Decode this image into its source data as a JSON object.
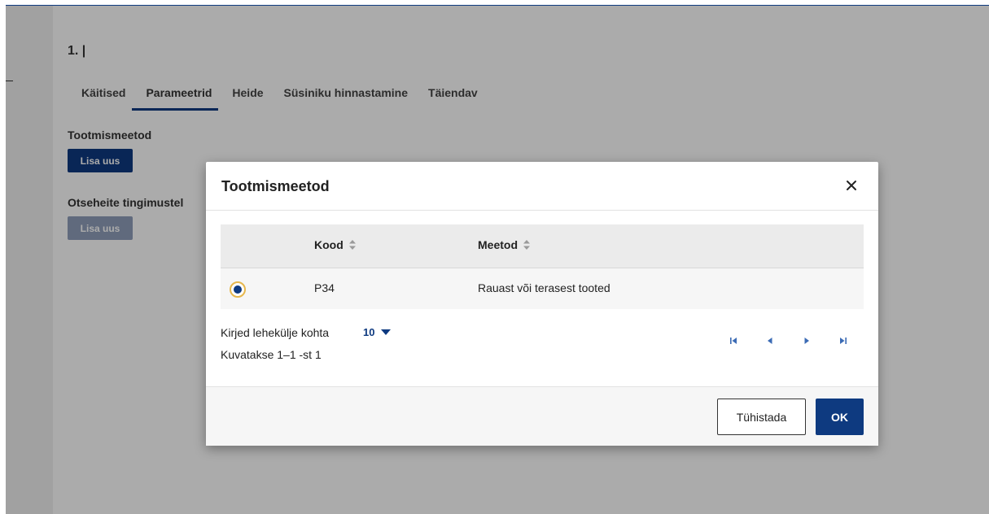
{
  "page": {
    "title": "1. |",
    "tabs": [
      {
        "label": "Käitised",
        "active": false
      },
      {
        "label": "Parameetrid",
        "active": true
      },
      {
        "label": "Heide",
        "active": false
      },
      {
        "label": "Süsiniku hinnastamine",
        "active": false
      },
      {
        "label": "Täiendav",
        "active": false
      }
    ],
    "sections": [
      {
        "label": "Tootmismeetod",
        "button": "Lisa uus",
        "enabled": true
      },
      {
        "label": "Otseheite tingimustel",
        "button": "Lisa uus",
        "enabled": false
      }
    ]
  },
  "modal": {
    "title": "Tootmismeetod",
    "close_icon": "close-icon",
    "columns": [
      {
        "label": "Kood",
        "sortable": true
      },
      {
        "label": "Meetod",
        "sortable": true
      }
    ],
    "rows": [
      {
        "selected": true,
        "kood": "P34",
        "meetod": "Rauast või terasest tooted"
      }
    ],
    "pagination": {
      "per_page_label": "Kirjed lehekülje kohta",
      "per_page_value": "10",
      "range_text": "Kuvatakse 1–1 -st 1",
      "nav_icons": [
        "first-page-icon",
        "prev-page-icon",
        "next-page-icon",
        "last-page-icon"
      ]
    },
    "footer": {
      "cancel_label": "Tühistada",
      "ok_label": "OK"
    }
  },
  "colors": {
    "primary": "#0e3a80",
    "primary_disabled": "#8f9fbb",
    "radio_ring": "#e6b74c",
    "nav_icon": "#3b6bb5"
  }
}
